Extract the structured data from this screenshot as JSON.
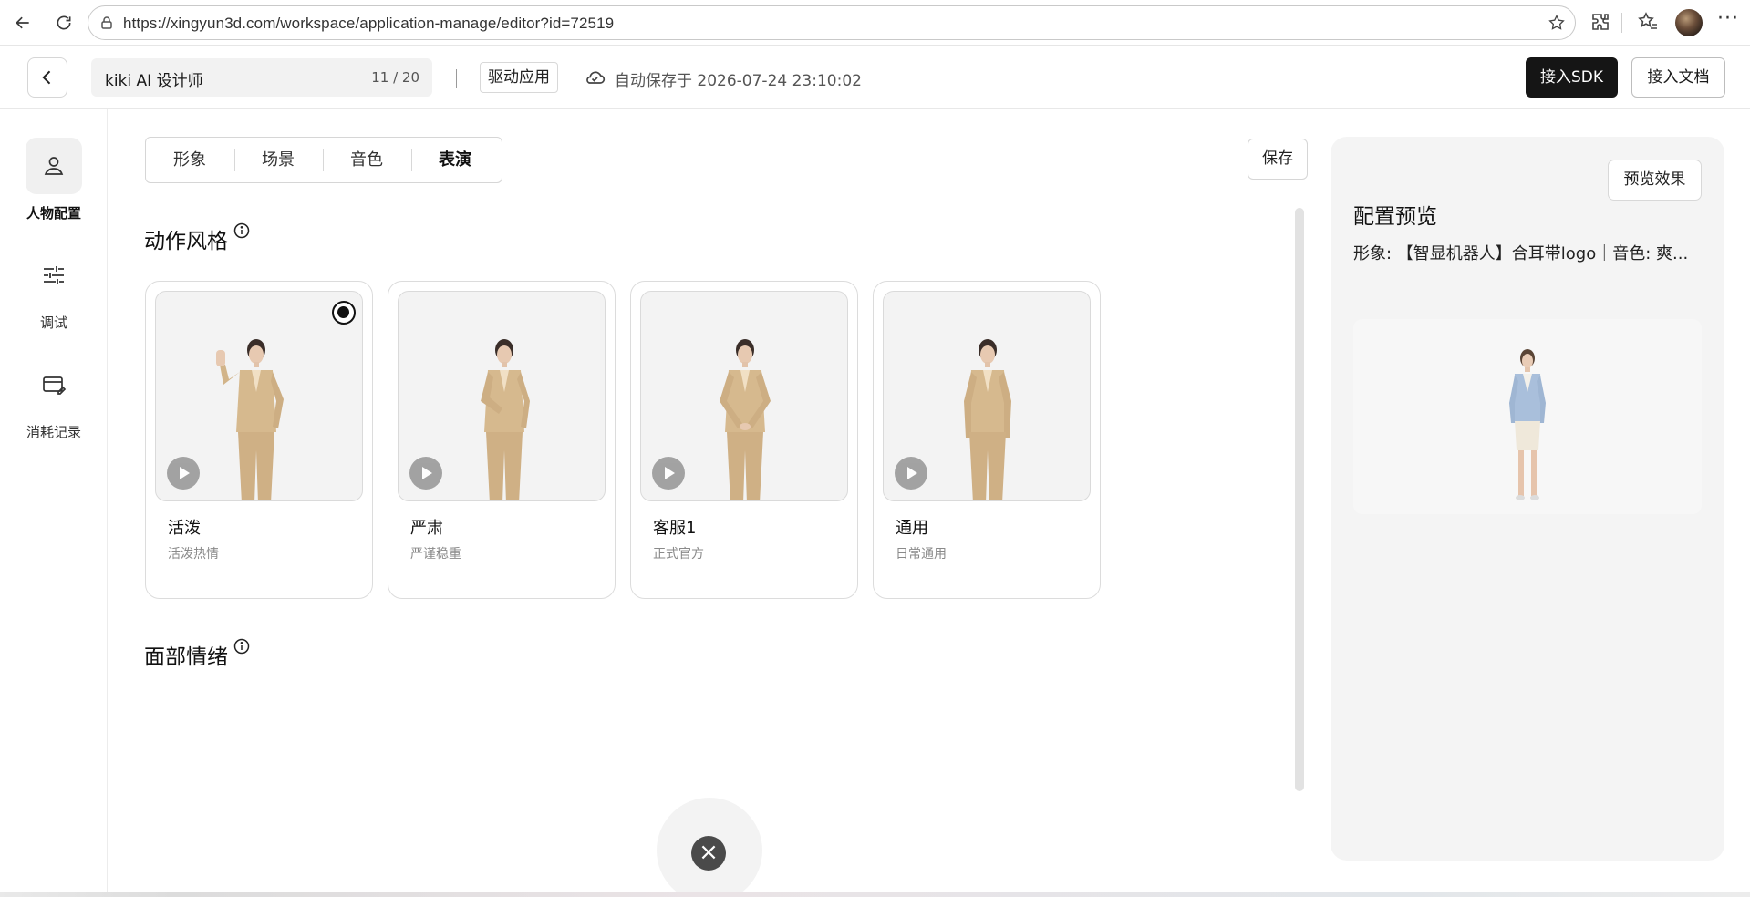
{
  "browser": {
    "url": "https://xingyun3d.com/workspace/application-manage/editor?id=72519"
  },
  "header": {
    "app_name": "kiki AI 设计师",
    "name_counter": "11 / 20",
    "drive_label": "驱动应用",
    "autosave": "自动保存于 2026-07-24 23:10:02",
    "sdk_button": "接入SDK",
    "docs_button": "接入文档"
  },
  "sidebar": {
    "items": [
      {
        "label": "人物配置",
        "icon": "person-icon",
        "active": true
      },
      {
        "label": "调试",
        "icon": "sliders-icon",
        "active": false
      },
      {
        "label": "消耗记录",
        "icon": "record-edit-icon",
        "active": false
      }
    ]
  },
  "tabs": [
    {
      "label": "形象",
      "active": false
    },
    {
      "label": "场景",
      "active": false
    },
    {
      "label": "音色",
      "active": false
    },
    {
      "label": "表演",
      "active": true
    }
  ],
  "save_button": "保存",
  "sections": {
    "action_style": "动作风格",
    "facial_emotion": "面部情绪"
  },
  "cards": [
    {
      "title": "活泼",
      "subtitle": "活泼热情",
      "selected": true,
      "pose": "wave"
    },
    {
      "title": "严肃",
      "subtitle": "严谨稳重",
      "selected": false,
      "pose": "hand-on-chest"
    },
    {
      "title": "客服1",
      "subtitle": "正式官方",
      "selected": false,
      "pose": "hands-clasped"
    },
    {
      "title": "通用",
      "subtitle": "日常通用",
      "selected": false,
      "pose": "standing"
    }
  ],
  "preview": {
    "button": "预览效果",
    "title": "配置预览",
    "info": "形象: 【智显机器人】合耳带logo｜音色: 爽..."
  },
  "colors": {
    "primary_dark": "#151515",
    "suit": "#d6b98e",
    "panel_bg": "#f4f4f4",
    "blazer_blue": "#a9bfdb"
  }
}
